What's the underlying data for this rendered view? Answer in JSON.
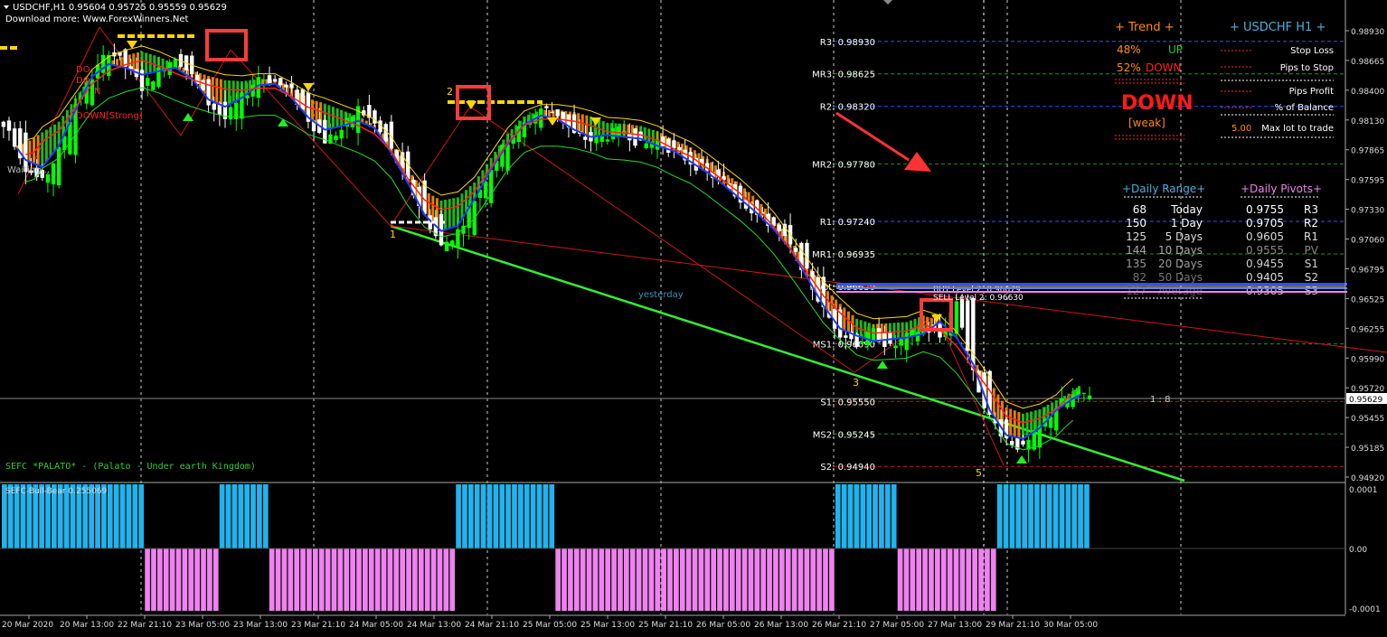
{
  "header": {
    "symbol_line": "USDCHF,H1  0.95604 0.95725 0.95559 0.95629",
    "download_note": "Download more: Www.ForexWinners.Net"
  },
  "colors": {
    "bg": "#000000",
    "bull_candle": "#00ff00",
    "bear_candle": "#ffffff",
    "ribbon_up": "#22cc22",
    "ribbon_down": "#ff8c00",
    "ma_blue": "#1e3cff",
    "ma_red": "#ff2020",
    "signal_yellow": "#ffd700",
    "trend_green": "#33ee33",
    "pivot_blue": "#3050ff",
    "pivot_green": "#1f8f1f",
    "pivot_red": "#c02020",
    "histo_cyan": "#1fb4ee",
    "histo_pink": "#ee82ee",
    "grid_white": "#ffffff",
    "axis": "#bbbbbb",
    "highlight_box": "#ff3b3b"
  },
  "price_axis": {
    "min": 0.9484,
    "max": 0.9903,
    "labels": [
      "0.98930",
      "0.98665",
      "0.98400",
      "0.98130",
      "0.97865",
      "0.97595",
      "0.97330",
      "0.97060",
      "0.96795",
      "0.96525",
      "0.96255",
      "0.95990",
      "0.95720",
      "0.95455",
      "0.95185",
      "0.94920"
    ],
    "current": "0.95629"
  },
  "time_axis": {
    "labels": [
      "20 Mar 2020",
      "20 Mar 13:00",
      "22 Mar 21:10",
      "23 Mar 05:00",
      "23 Mar 13:00",
      "23 Mar 21:10",
      "24 Mar 05:00",
      "24 Mar 13:00",
      "24 Mar 21:10",
      "25 Mar 05:00",
      "25 Mar 13:00",
      "25 Mar 21:10",
      "26 Mar 05:00",
      "26 Mar 13:00",
      "26 Mar 21:10",
      "27 Mar 05:00",
      "27 Mar 13:00",
      "29 Mar 21:10",
      "30 Mar 05:00"
    ]
  },
  "pivot_levels": [
    {
      "label": "R3: 0.98930",
      "price": 0.9893,
      "color": "blue"
    },
    {
      "label": "MR3: 0.98625",
      "price": 0.98625,
      "color": "green"
    },
    {
      "label": "R2: 0.98320",
      "price": 0.9832,
      "color": "blue"
    },
    {
      "label": "MR2: 0.97780",
      "price": 0.9778,
      "color": "green"
    },
    {
      "label": "R1: 0.97240",
      "price": 0.9724,
      "color": "blue"
    },
    {
      "label": "MR1: 0.96935",
      "price": 0.96935,
      "color": "green"
    },
    {
      "label": "Pivot: 0.96630",
      "price": 0.9663,
      "color": "white"
    },
    {
      "label": "MS1: 0.96090",
      "price": 0.9609,
      "color": "green"
    },
    {
      "label": "S1: 0.95550",
      "price": 0.9555,
      "color": "red"
    },
    {
      "label": "MS2: 0.95245",
      "price": 0.95245,
      "color": "green"
    },
    {
      "label": "S2: 0.94940",
      "price": 0.9494,
      "color": "red"
    }
  ],
  "chart_labels": {
    "yesterday": "yesterday",
    "ratio": "1 : 8",
    "waiting": "Waiting...",
    "buy_level": "BUY Level 2: 0.96679",
    "sell_level": "SELL Level 2: 0.96630",
    "wave_1": "1",
    "wave_2": "2",
    "wave_3": "3",
    "wave_5": "5",
    "left_signal_down": "DOWN[Strong]",
    "left_signal_fragments": [
      "DO",
      "DO",
      "N"
    ],
    "footer_caption": "SEFC *PALATO* - (Palato - Under earth Kingdom)"
  },
  "trend_panel": {
    "title": "+  Trend  +",
    "up_pct": "48%",
    "up_label": "UP",
    "down_pct": "52%",
    "down_label": "DOWN",
    "big_signal": "DOWN",
    "strength": "[weak]"
  },
  "symbol_panel": {
    "title": "+  USDCHF  H1  +",
    "stop_loss": "Stop Loss",
    "pips_to_stop": "Pips to Stop",
    "pips_profit": "Pips Profit",
    "pct_balance": "% of Balance",
    "max_lot_value": "5.00",
    "max_lot_label": "Max lot to trade"
  },
  "daily_range": {
    "title": "+Daily Range+",
    "rows": [
      {
        "value": "68",
        "label": "Today"
      },
      {
        "value": "150",
        "label": "1 Day"
      },
      {
        "value": "125",
        "label": "5 Days"
      },
      {
        "value": "144",
        "label": "10 Days"
      },
      {
        "value": "135",
        "label": "20 Days"
      },
      {
        "value": "82",
        "label": "50 Days"
      },
      {
        "value": "127",
        "label": "Average"
      }
    ]
  },
  "daily_pivots": {
    "title": "+Daily Pivots+",
    "rows": [
      {
        "value": "0.9755",
        "label": "R3"
      },
      {
        "value": "0.9705",
        "label": "R2"
      },
      {
        "value": "0.9605",
        "label": "R1"
      },
      {
        "value": "0.9555",
        "label": "PV"
      },
      {
        "value": "0.9455",
        "label": "S1"
      },
      {
        "value": "0.9405",
        "label": "S2"
      },
      {
        "value": "0.9305",
        "label": "S3"
      }
    ]
  },
  "indicator": {
    "name": "SEFC-Bull-Bear 0.255069",
    "axis_labels": [
      "0.0001",
      "0.00",
      "-0.0001"
    ]
  },
  "chart_data": {
    "type": "candlestick",
    "series": [
      {
        "name": "USDCHF,H1",
        "close": [
          0.981,
          0.9775,
          0.976,
          0.979,
          0.9835,
          0.986,
          0.9885,
          0.987,
          0.985,
          0.9865,
          0.988,
          0.986,
          0.9835,
          0.982,
          0.984,
          0.986,
          0.9855,
          0.9845,
          0.982,
          0.98,
          0.981,
          0.983,
          0.9815,
          0.979,
          0.976,
          0.973,
          0.97,
          0.9715,
          0.9745,
          0.9775,
          0.98,
          0.9815,
          0.983,
          0.9825,
          0.9805,
          0.98,
          0.9805,
          0.981,
          0.9795,
          0.98,
          0.979,
          0.978,
          0.977,
          0.976,
          0.9745,
          0.973,
          0.972,
          0.97,
          0.9675,
          0.964,
          0.962,
          0.961,
          0.962,
          0.9605,
          0.9615,
          0.9625,
          0.9615,
          0.965,
          0.958,
          0.954,
          0.952,
          0.951,
          0.953,
          0.955,
          0.956,
          0.9563
        ]
      }
    ],
    "ylim": [
      0.9484,
      0.9903
    ]
  },
  "indicator_data": {
    "bars": [
      1,
      1,
      1,
      1,
      1,
      1,
      1,
      1,
      1,
      1,
      1,
      1,
      1,
      1,
      1,
      1,
      1,
      1,
      1,
      1,
      1,
      1,
      1,
      -1,
      -1,
      -1,
      -1,
      -1,
      -1,
      -1,
      -1,
      -1,
      -1,
      -1,
      -1,
      1,
      1,
      1,
      1,
      1,
      1,
      1,
      1,
      -1,
      -1,
      -1,
      -1,
      -1,
      -1,
      -1,
      -1,
      -1,
      -1,
      -1,
      -1,
      -1,
      -1,
      -1,
      -1,
      -1,
      -1,
      -1,
      -1,
      -1,
      -1,
      -1,
      -1,
      -1,
      -1,
      -1,
      -1,
      -1,
      -1,
      1,
      1,
      1,
      1,
      1,
      1,
      1,
      1,
      1,
      1,
      1,
      1,
      1,
      1,
      1,
      1,
      -1,
      -1,
      -1,
      -1,
      -1,
      -1,
      -1,
      -1,
      -1,
      -1,
      -1,
      -1,
      -1,
      -1,
      -1,
      -1,
      -1,
      -1,
      -1,
      -1,
      -1,
      -1,
      -1,
      -1,
      -1,
      -1,
      -1,
      -1,
      -1,
      -1,
      -1,
      -1,
      -1,
      -1,
      -1,
      -1,
      -1,
      -1,
      -1,
      -1,
      -1,
      -1,
      -1,
      -1,
      -1,
      1,
      1,
      1,
      1,
      1,
      1,
      1,
      1,
      1,
      1,
      -1,
      -1,
      -1,
      -1,
      -1,
      -1,
      -1,
      -1,
      -1,
      -1,
      -1,
      -1,
      -1,
      -1,
      -1,
      -1,
      1,
      1,
      1,
      1,
      1,
      1,
      1,
      1,
      1,
      1,
      1,
      1,
      1,
      1,
      1
    ]
  }
}
